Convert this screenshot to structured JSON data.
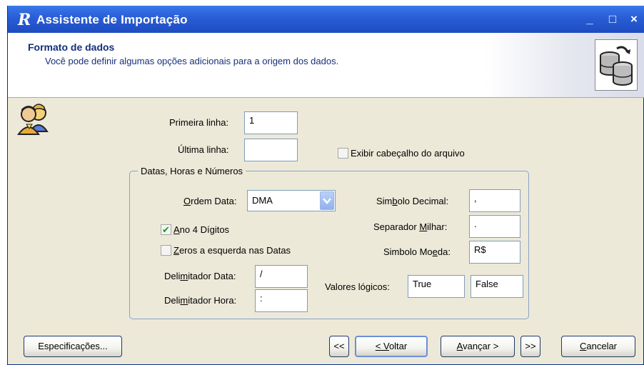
{
  "window": {
    "title": "Assistente de Importação",
    "title_icon": "R",
    "controls": {
      "minimize": "_",
      "maximize": "□",
      "close": "×"
    }
  },
  "header": {
    "title": "Formato de dados",
    "subtitle": "Você pode definir algumas opções adicionais para a origem dos dados."
  },
  "form": {
    "primeira_linha": {
      "label": "Primeira linha:",
      "value": "1"
    },
    "ultima_linha": {
      "label": "Última linha:",
      "value": ""
    },
    "exibir_cabecalho": {
      "label": "Exibir cabeçalho do arquivo",
      "checked": false
    }
  },
  "group": {
    "legend": "Datas, Horas e Números",
    "ordem_data": {
      "label": "Ordem Data:",
      "value": "DMA"
    },
    "ano4": {
      "label": "Ano 4 Dígitos",
      "checked": true
    },
    "zeros": {
      "label": "Zeros a esquerda nas Datas",
      "checked": false
    },
    "delim_data": {
      "label": "Delimitador Data:",
      "value": "/"
    },
    "delim_hora": {
      "label": "Delimitador Hora:",
      "value": ":"
    },
    "simbolo_decimal": {
      "label": "Simbolo Decimal:",
      "value": ","
    },
    "separador_milhar": {
      "label": "Separador Milhar:",
      "value": "."
    },
    "simbolo_moeda": {
      "label": "Simbolo Moeda:",
      "value": "R$"
    },
    "valores_logicos": {
      "label": "Valores lógicos:",
      "true_value": "True",
      "false_value": "False"
    }
  },
  "buttons": {
    "especificacoes": "Especificações...",
    "first": "<<",
    "voltar": "< Voltar",
    "avancar": "Avançar >",
    "last": ">>",
    "cancelar": "Cancelar"
  },
  "colors": {
    "titlebar": "#2a5fd8",
    "header_text": "#15307a",
    "dialog_bg": "#ece9d8",
    "check_mark": "#1b9a1b"
  }
}
